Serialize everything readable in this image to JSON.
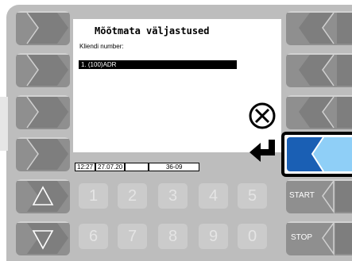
{
  "screen": {
    "title": "Mõõtmata väljastused",
    "customer_label": "Kliendi number:",
    "selected_item": "1.  (100)ADR"
  },
  "status_bar": {
    "time": "12:27",
    "date": "27.07.20",
    "empty": "",
    "code": "36-09"
  },
  "keypad": {
    "row1": [
      "1",
      "2",
      "3",
      "4",
      "5"
    ],
    "row2": [
      "6",
      "7",
      "8",
      "9",
      "0"
    ]
  },
  "side_keys": {
    "start": "START",
    "stop": "STOP"
  },
  "icons": {
    "cancel": "x-circle-icon",
    "enter": "enter-arrow-icon",
    "up": "triangle-up-icon",
    "down": "triangle-down-icon"
  },
  "colors": {
    "frame": "#bdbdbd",
    "button": "#8f8f8f",
    "active_button": "#1a5fb4",
    "active_highlight": "#8fcff7"
  }
}
